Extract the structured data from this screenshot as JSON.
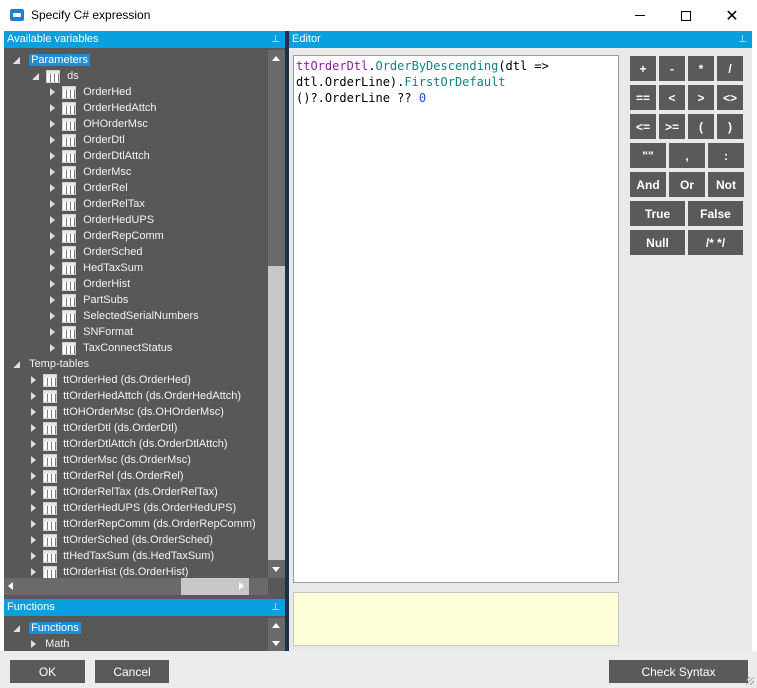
{
  "window": {
    "title": "Specify C# expression",
    "minimize_icon": "minimize-icon",
    "maximize_icon": "maximize-icon",
    "close_icon": "close-icon"
  },
  "variables_panel": {
    "header": "Available variables",
    "pin": "pin-icon",
    "nodes": [
      {
        "label": "Parameters",
        "level": 0,
        "selected": true
      },
      {
        "label": "ds",
        "level": 1
      },
      {
        "label": "OrderHed",
        "level": 2
      },
      {
        "label": "OrderHedAttch",
        "level": 2
      },
      {
        "label": "OHOrderMsc",
        "level": 2
      },
      {
        "label": "OrderDtl",
        "level": 2
      },
      {
        "label": "OrderDtlAttch",
        "level": 2
      },
      {
        "label": "OrderMsc",
        "level": 2
      },
      {
        "label": "OrderRel",
        "level": 2
      },
      {
        "label": "OrderRelTax",
        "level": 2
      },
      {
        "label": "OrderHedUPS",
        "level": 2
      },
      {
        "label": "OrderRepComm",
        "level": 2
      },
      {
        "label": "OrderSched",
        "level": 2
      },
      {
        "label": "HedTaxSum",
        "level": 2
      },
      {
        "label": "OrderHist",
        "level": 2
      },
      {
        "label": "PartSubs",
        "level": 2
      },
      {
        "label": "SelectedSerialNumbers",
        "level": 2
      },
      {
        "label": "SNFormat",
        "level": 2
      },
      {
        "label": "TaxConnectStatus",
        "level": 2
      },
      {
        "label": "Temp-tables",
        "level": 0
      },
      {
        "label": "ttOrderHed (ds.OrderHed)",
        "level": 1
      },
      {
        "label": "ttOrderHedAttch (ds.OrderHedAttch)",
        "level": 1
      },
      {
        "label": "ttOHOrderMsc (ds.OHOrderMsc)",
        "level": 1
      },
      {
        "label": "ttOrderDtl (ds.OrderDtl)",
        "level": 1
      },
      {
        "label": "ttOrderDtlAttch (ds.OrderDtlAttch)",
        "level": 1
      },
      {
        "label": "ttOrderMsc (ds.OrderMsc)",
        "level": 1
      },
      {
        "label": "ttOrderRel (ds.OrderRel)",
        "level": 1
      },
      {
        "label": "ttOrderRelTax (ds.OrderRelTax)",
        "level": 1
      },
      {
        "label": "ttOrderHedUPS (ds.OrderHedUPS)",
        "level": 1
      },
      {
        "label": "ttOrderRepComm (ds.OrderRepComm)",
        "level": 1
      },
      {
        "label": "ttOrderSched (ds.OrderSched)",
        "level": 1
      },
      {
        "label": "ttHedTaxSum (ds.HedTaxSum)",
        "level": 1
      },
      {
        "label": "ttOrderHist (ds.OrderHist)",
        "level": 1
      }
    ]
  },
  "functions_panel": {
    "header": "Functions",
    "pin": "pin-icon",
    "nodes": [
      {
        "label": "Functions",
        "selected": true
      },
      {
        "label": "Math"
      }
    ]
  },
  "editor": {
    "header": "Editor",
    "pin": "pin-icon",
    "line1_a": "ttOrderDtl",
    "line1_b": ".",
    "line1_c": "OrderByDescending",
    "line1_d": "(dtl =>",
    "line2_a": "dtl.OrderLine).",
    "line2_b": "FirstOrDefault",
    "line3_a": "()?.OrderLine ?? ",
    "line3_b": "0",
    "message": ""
  },
  "operators": [
    "+",
    "-",
    "*",
    "/",
    "==",
    "<",
    ">",
    "<>",
    "<=",
    ">=",
    "(",
    ")",
    "\"\"",
    ",",
    ":",
    "And",
    "Or",
    "Not",
    "True",
    "False",
    "Null",
    "/* */"
  ],
  "buttons": {
    "ok": "OK",
    "cancel": "Cancel",
    "check_syntax": "Check Syntax"
  },
  "colors": {
    "accent": "#0aa0e0",
    "panel_bg": "#585858",
    "button_bg": "#5a5a5a",
    "selection": "#1e8fd6"
  }
}
